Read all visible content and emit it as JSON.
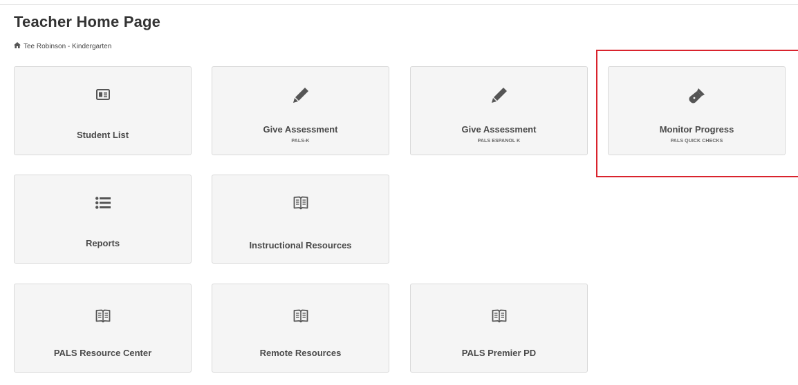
{
  "page": {
    "title": "Teacher Home Page",
    "breadcrumb": "Tee Robinson - Kindergarten"
  },
  "tiles": {
    "student_list": {
      "label": "Student List",
      "icon": "id-card-icon"
    },
    "give_assessment_pals_k": {
      "label": "Give Assessment",
      "sub": "PALS-K",
      "icon": "pencil-icon"
    },
    "give_assessment_espanol": {
      "label": "Give Assessment",
      "sub": "PALS ESPANOL K",
      "icon": "pencil-icon"
    },
    "monitor_progress": {
      "label": "Monitor Progress",
      "sub": "PALS QUICK CHECKS",
      "icon": "flashlight-icon"
    },
    "reports": {
      "label": "Reports",
      "icon": "list-icon"
    },
    "instructional_resources": {
      "label": "Instructional Resources",
      "icon": "book-icon"
    },
    "pals_resource_center": {
      "label": "PALS Resource Center",
      "icon": "book-icon"
    },
    "remote_resources": {
      "label": "Remote Resources",
      "icon": "book-icon"
    },
    "pals_premier_pd": {
      "label": "PALS Premier PD",
      "icon": "book-icon"
    }
  },
  "colors": {
    "tile_bg": "#f5f5f5",
    "tile_border": "#d9d9d9",
    "icon": "#555555",
    "highlight": "#d9232d"
  }
}
